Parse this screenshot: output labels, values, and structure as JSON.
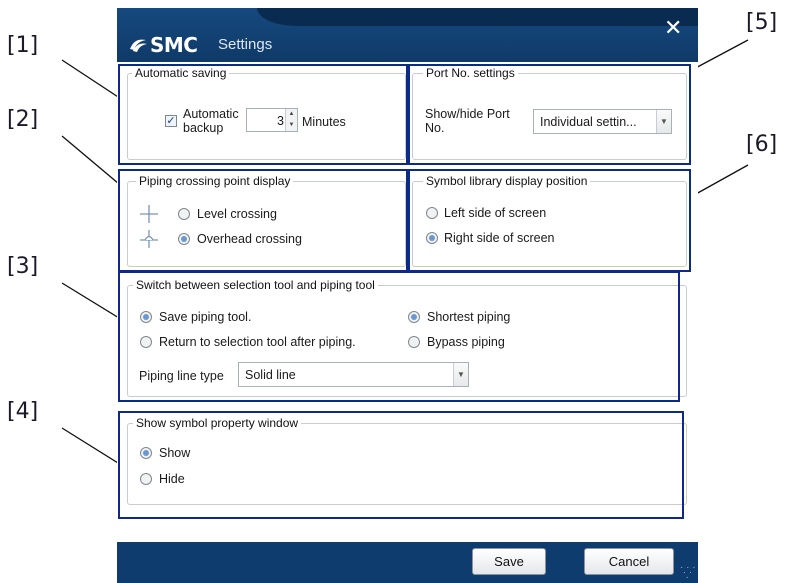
{
  "window": {
    "brand": "SMC",
    "title": "Settings"
  },
  "callouts": [
    "[1]",
    "[2]",
    "[3]",
    "[4]",
    "[5]",
    "[6]"
  ],
  "automatic_saving": {
    "legend": "Automatic saving",
    "checkbox_label_line1": "Automatic",
    "checkbox_label_line2": "backup",
    "checked": true,
    "value": "3",
    "unit": "Minutes"
  },
  "port_no": {
    "legend": "Port No. settings",
    "label_line1": "Show/hide Port",
    "label_line2": "No.",
    "selected": "Individual settin..."
  },
  "piping_crossing": {
    "legend": "Piping crossing point display",
    "options": [
      {
        "label": "Level crossing",
        "selected": false
      },
      {
        "label": "Overhead crossing",
        "selected": true
      }
    ]
  },
  "symbol_library": {
    "legend": "Symbol library display position",
    "options": [
      {
        "label": "Left side of screen",
        "selected": false
      },
      {
        "label": "Right side of screen",
        "selected": true
      }
    ]
  },
  "switch_tool": {
    "legend": "Switch between selection tool and piping tool",
    "options": [
      {
        "label": "Save piping tool.",
        "selected": true
      },
      {
        "label": "Return to selection tool after piping.",
        "selected": false
      }
    ],
    "routing": [
      {
        "label": "Shortest piping",
        "selected": true
      },
      {
        "label": "Bypass piping",
        "selected": false
      }
    ],
    "line_type_label": "Piping line type",
    "line_type_value": "Solid line"
  },
  "symbol_property": {
    "legend": "Show symbol property window",
    "options": [
      {
        "label": "Show",
        "selected": true
      },
      {
        "label": "Hide",
        "selected": false
      }
    ]
  },
  "buttons": {
    "save": "Save",
    "cancel": "Cancel"
  },
  "colors": {
    "title_bar": "#0f3c6e",
    "highlight_border": "#0c2a8a",
    "radio_selected": "#6a99d1"
  }
}
